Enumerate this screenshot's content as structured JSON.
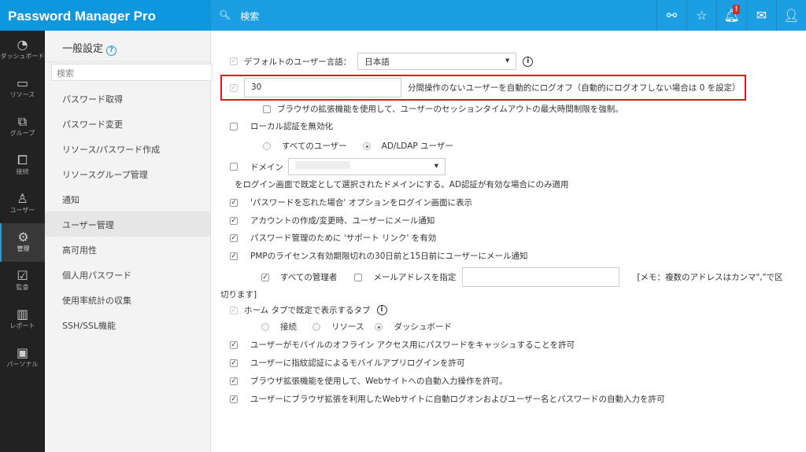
{
  "header": {
    "logo": "Password Manager Pro",
    "search_placeholder": "検索",
    "notification_badge": "!"
  },
  "rail": [
    {
      "label": "ダッシュボード",
      "icon": "dashboard-icon"
    },
    {
      "label": "リソース",
      "icon": "monitor-icon"
    },
    {
      "label": "グループ",
      "icon": "group-icon"
    },
    {
      "label": "接続",
      "icon": "connect-icon"
    },
    {
      "label": "ユーザー",
      "icon": "user-icon"
    },
    {
      "label": "管理",
      "icon": "gear-icon"
    },
    {
      "label": "監査",
      "icon": "clipboard-icon"
    },
    {
      "label": "レポート",
      "icon": "chart-icon"
    },
    {
      "label": "パーソナル",
      "icon": "personal-icon"
    }
  ],
  "sub": {
    "title": "一般設定",
    "search_placeholder": "検索",
    "items": [
      "パスワード取得",
      "パスワード変更",
      "リソース/パスワード作成",
      "リソースグループ管理",
      "通知",
      "ユーザー管理",
      "高可用性",
      "個人用パスワード",
      "使用率統計の収集",
      "SSH/SSL機能"
    ]
  },
  "main": {
    "lang_label": "デフォルトのユーザー言語：",
    "lang_value": "日本語",
    "timeout_value": "30",
    "timeout_label": "分間操作のないユーザーを自動的にログオフ（自動的にログオフしない場合は 0 を設定）",
    "browser_timeout": "ブラウザの拡張機能を使用して、ユーザーのセッションタイムアウトの最大時間制限を強制。",
    "disable_local": "ローカル認証を無効化",
    "all_users": "すべてのユーザー",
    "ad_users": "AD/LDAP ユーザー",
    "domain": "ドメイン",
    "domain_desc": "をログイン画面で既定として選択されたドメインにする。AD認証が有効な場合にのみ適用",
    "forgot": "'パスワードを忘れた場合' オプションをログイン画面に表示",
    "account_mail": "アカウントの作成/変更時、ユーザーにメール通知",
    "support_link": "パスワード管理のために 'サポート リンク' を有効",
    "license_mail": "PMPのライセンス有効期限切れの30日前と15日前にユーザーにメール通知",
    "all_admins": "すべての管理者",
    "specify_mail": "メールアドレスを指定",
    "mail_note": "[メモ：複数のアドレスはカンマ\",\"で区",
    "mail_note_cont": "切ります]",
    "home_tab": "ホーム タブで既定で表示するタブ",
    "tab_connect": "接続",
    "tab_resource": "リソース",
    "tab_dashboard": "ダッシュボード",
    "offline": "ユーザーがモバイルのオフライン アクセス用にパスワードをキャッシュすることを許可",
    "fingerprint": "ユーザーに指紋認証によるモバイルアプリログインを許可",
    "autofill": "ブラウザ拡張機能を使用して、Webサイトへの自動入力操作を許可。",
    "autologon": "ユーザーにブラウザ拡張を利用したWebサイトに自動ログオンおよびユーザー名とパスワードの自動入力を許可"
  }
}
